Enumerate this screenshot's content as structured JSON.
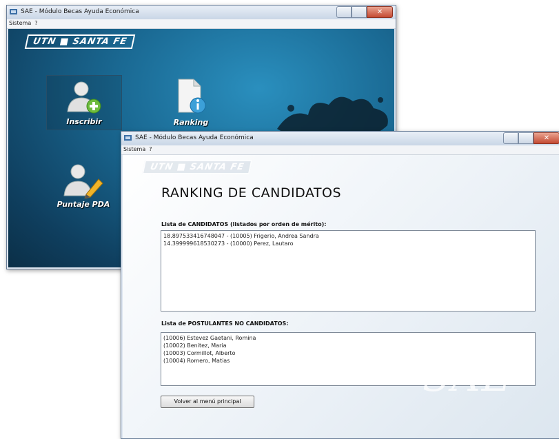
{
  "main_window": {
    "title": "SAE - Módulo Becas Ayuda Económica",
    "menu": [
      "Sistema",
      "?"
    ],
    "close_symbol": "✕",
    "logo": "UTN ■ SANTA FE",
    "tiles": [
      {
        "label": "Inscribir",
        "icon": "add-user-icon"
      },
      {
        "label": "Ranking",
        "icon": "document-info-icon"
      },
      {
        "label": "Puntaje PDA",
        "icon": "user-edit-icon"
      }
    ]
  },
  "ranking_window": {
    "title": "SAE - Módulo Becas Ayuda Económica",
    "menu": [
      "Sistema",
      "?"
    ],
    "close_symbol": "✕",
    "logo": "UTN ■ SANTA FE",
    "heading": "RANKING DE CANDIDATOS",
    "candidates_label": "Lista de CANDIDATOS (listados por orden de mérito):",
    "candidates": [
      "18.897533416748047 - (10005)  Frigerio, Andrea Sandra",
      "14.399999618530273 - (10000)  Perez, Lautaro"
    ],
    "non_candidates_label": "Lista de POSTULANTES NO CANDIDATOS:",
    "non_candidates": [
      "(10006)  Estevez Gaetani, Romina",
      "(10002)  Benitez, Maria",
      "(10003)  Cormillot, Alberto",
      "(10004)  Romero, Matias"
    ],
    "back_button": "Volver al menú principal",
    "watermark": "SAE"
  },
  "colors": {
    "accent_dark": "#0f3f5f",
    "accent_light": "#2a8fbe",
    "close_red": "#c44a33"
  }
}
